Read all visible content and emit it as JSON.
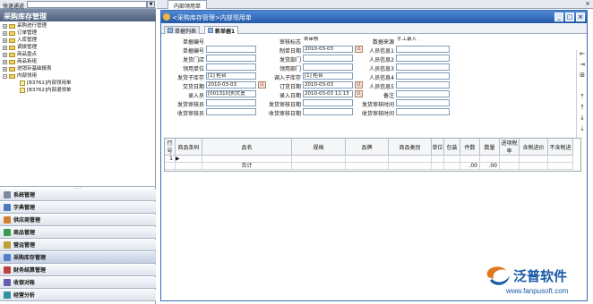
{
  "quick": {
    "label": "快速通道"
  },
  "left": {
    "title": "采购库存管理",
    "tree": [
      {
        "label": "采购进行管理",
        "kind": "plus",
        "indent": 0
      },
      {
        "label": "订单管理",
        "kind": "plus",
        "indent": 0
      },
      {
        "label": "入库管理",
        "kind": "plus",
        "indent": 0
      },
      {
        "label": "调拨管理",
        "kind": "plus",
        "indent": 0
      },
      {
        "label": "商品盘点",
        "kind": "plus",
        "indent": 0
      },
      {
        "label": "商品拆组",
        "kind": "plus",
        "indent": 0
      },
      {
        "label": "进销存基础报表",
        "kind": "plus",
        "indent": 0
      },
      {
        "label": "内部领用",
        "kind": "minus",
        "indent": 0
      },
      {
        "label": "[B3761]内部领用单",
        "kind": "doc",
        "indent": 1
      },
      {
        "label": "[B3762]内部退领单",
        "kind": "doc",
        "indent": 1
      }
    ],
    "modules": [
      {
        "label": "系统管理",
        "icon": "gear-icon",
        "color": "#7a8aa0"
      },
      {
        "label": "字典管理",
        "icon": "book-icon",
        "color": "#4a7ac0"
      },
      {
        "label": "供应商管理",
        "icon": "supplier-icon",
        "color": "#d08030"
      },
      {
        "label": "商品管理",
        "icon": "goods-icon",
        "color": "#3a9a50"
      },
      {
        "label": "营运管理",
        "icon": "operation-icon",
        "color": "#c0a030"
      },
      {
        "label": "采购库存管理",
        "icon": "warehouse-icon",
        "color": "#5080c8",
        "active": true
      },
      {
        "label": "财务结算管理",
        "icon": "finance-icon",
        "color": "#c04040"
      },
      {
        "label": "收银对账",
        "icon": "cashier-icon",
        "color": "#6a5ab0"
      },
      {
        "label": "经营分析",
        "icon": "analysis-icon",
        "color": "#3090a0"
      }
    ]
  },
  "right": {
    "tab": "内部领用单",
    "window_title": "<采购库存管理>内部领用单",
    "subtabs": [
      "单据列表",
      "新单据1"
    ],
    "fields": {
      "doc_no": {
        "label": "单据编号",
        "value": ""
      },
      "audit_flag": {
        "label": "审核标志",
        "value": "未审核"
      },
      "data_source": {
        "label": "数据来源",
        "value": "手工录入"
      },
      "doc_no2": {
        "label": "单据编号",
        "value": ""
      },
      "create_date": {
        "label": "制单日期",
        "value": "2010-03-03"
      },
      "staff1": {
        "label": "人员信息1",
        "value": ""
      },
      "ship_store": {
        "label": "发货门店",
        "value": ""
      },
      "ship_dept": {
        "label": "发货部门",
        "value": ""
      },
      "staff2": {
        "label": "人员信息2",
        "value": ""
      },
      "recv_unit": {
        "label": "领用单位",
        "value": ""
      },
      "recv_dept": {
        "label": "领用部门",
        "value": ""
      },
      "staff3": {
        "label": "人员信息3",
        "value": ""
      },
      "ship_sub": {
        "label": "发货子库存",
        "value": "[1] 柜台"
      },
      "in_sub": {
        "label": "调入子库存",
        "value": "[1] 柜台"
      },
      "staff4": {
        "label": "人员信息4",
        "value": ""
      },
      "deliver_date": {
        "label": "交货日期",
        "value": "2010-03-03"
      },
      "order_date": {
        "label": "订货日期",
        "value": "2010-03-03"
      },
      "staff5": {
        "label": "人员信息5",
        "value": ""
      },
      "entry_person": {
        "label": "录入员",
        "value": "[001310]刘文勇"
      },
      "entry_date": {
        "label": "录入日期",
        "value": "2010-03-03 11:13"
      },
      "remark": {
        "label": "备注",
        "value": ""
      },
      "ship_auditor": {
        "label": "发货审核员",
        "value": ""
      },
      "ship_audit_date": {
        "label": "发货审核日期",
        "value": ""
      },
      "ship_audit_time": {
        "label": "发货审核时间",
        "value": ""
      },
      "recv_auditor": {
        "label": "收货审核员",
        "value": ""
      },
      "recv_audit_date": {
        "label": "收货审核日期",
        "value": ""
      },
      "recv_audit_time": {
        "label": "收货审核时间",
        "value": ""
      }
    },
    "grid": {
      "headers": [
        "行号",
        "商品条码",
        "品名",
        "规格",
        "品牌",
        "商品类别",
        "单位",
        "包装",
        "件数",
        "数量",
        "进项税率",
        "含税进价",
        "不含税进"
      ],
      "row1": {
        "no": "1"
      },
      "total": {
        "label": "合计",
        "qty1": ".00",
        "qty2": ".00"
      }
    }
  },
  "logo": {
    "name": "泛普软件",
    "url": "www.fanpusoft.com",
    "brand_color": "#1a5aa8"
  }
}
